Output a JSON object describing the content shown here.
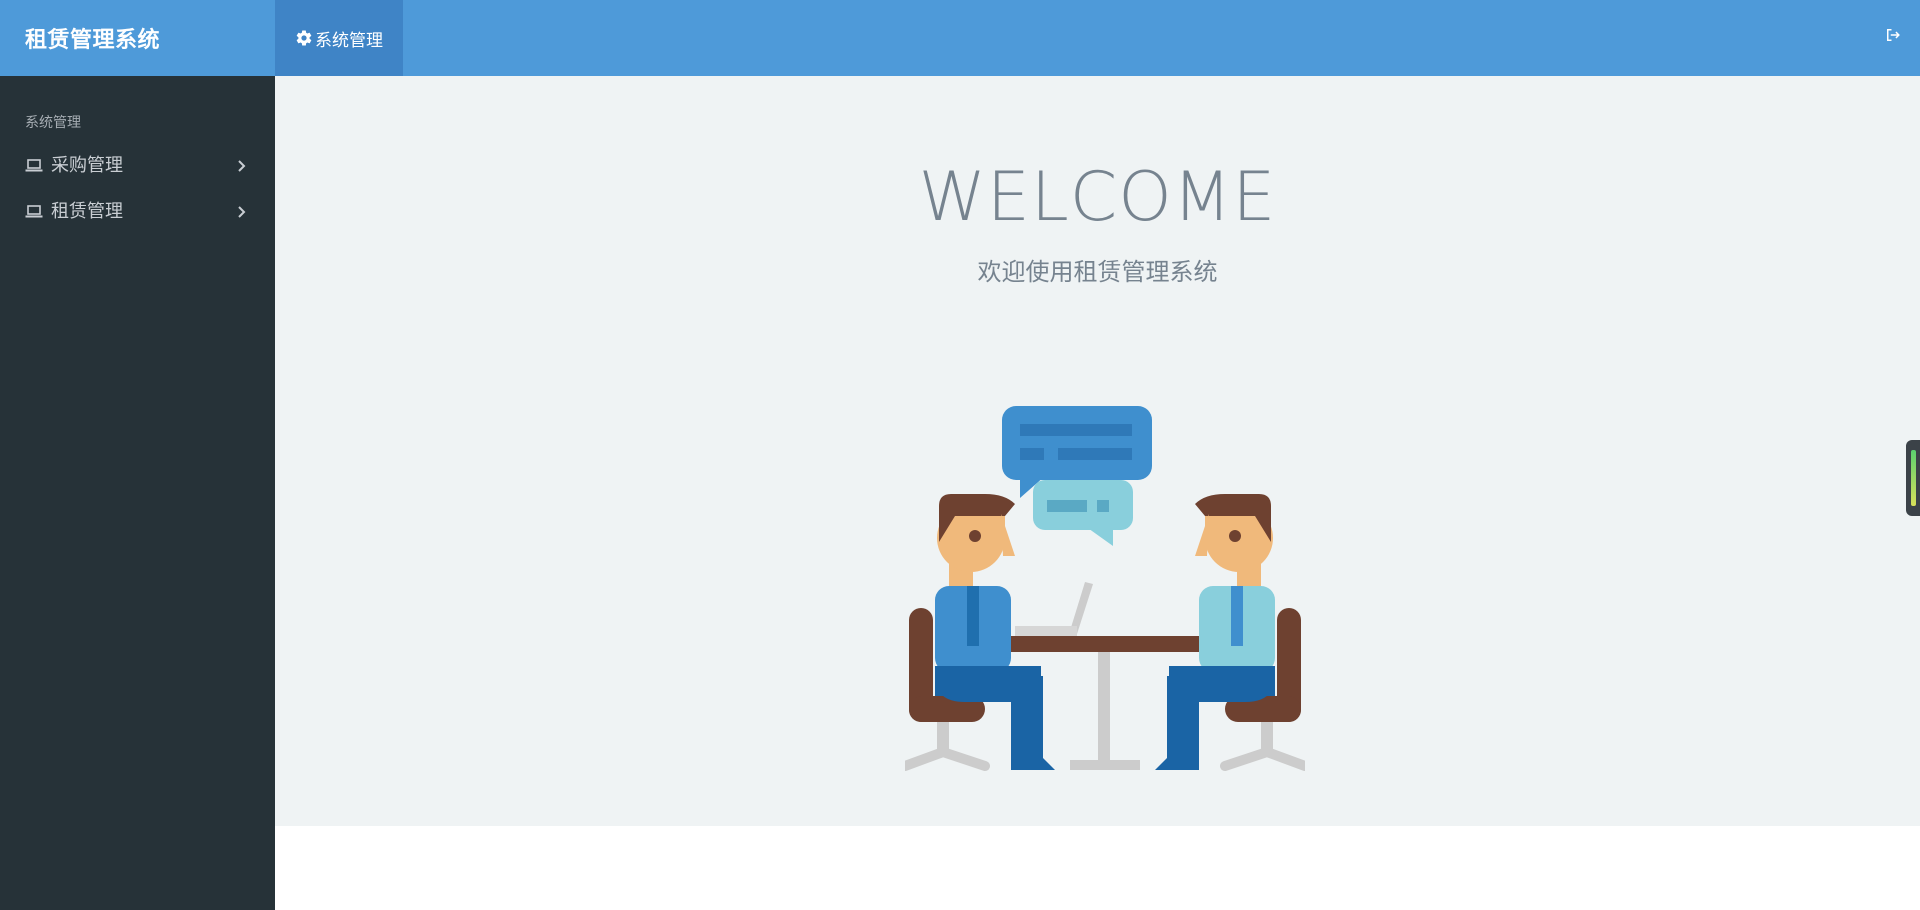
{
  "app": {
    "title": "租赁管理系统"
  },
  "header": {
    "tab_label": "系统管理",
    "tab_icon": "gear-icon",
    "logout_icon": "logout-icon"
  },
  "sidebar": {
    "heading": "系统管理",
    "items": [
      {
        "label": "采购管理",
        "icon": "laptop-icon"
      },
      {
        "label": "租赁管理",
        "icon": "laptop-icon"
      }
    ]
  },
  "main": {
    "welcome": "WELCOME",
    "subtitle": "欢迎使用租赁管理系统"
  },
  "colors": {
    "header_bg": "#4e9ad9",
    "header_tab_active": "#3f84c6",
    "sidebar_bg": "#263238",
    "main_bg": "#eff3f4",
    "text_muted": "#76838f"
  }
}
